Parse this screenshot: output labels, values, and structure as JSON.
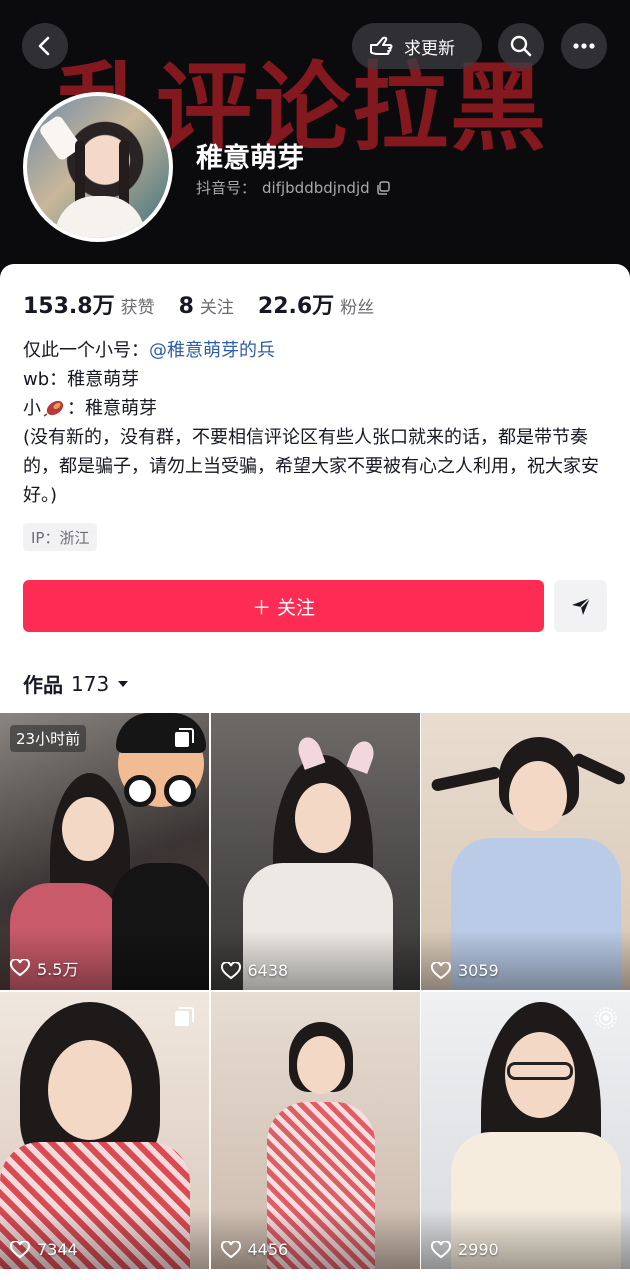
{
  "header": {
    "banner_text": "乱评论拉黑",
    "update_label": "求更新",
    "profile_name": "稚意萌芽",
    "douyin_id_label": "抖音号：",
    "douyin_id": "difjbddbdjndjd"
  },
  "stats": [
    {
      "value": "153.8万",
      "label": "获赞"
    },
    {
      "value": "8",
      "label": "关注"
    },
    {
      "value": "22.6万",
      "label": "粉丝"
    }
  ],
  "bio": {
    "line1_prefix": "仅此一个小号：",
    "line1_mention": "@稚意萌芽的兵",
    "line2": "wb：稚意萌芽",
    "line3_prefix": "小",
    "line3_suffix": "：稚意萌芽",
    "paragraph": "(没有新的，没有群，不要相信评论区有些人张口就来的话，都是带节奏的，都是骗子，请勿上当受骗，希望大家不要被有心之人利用，祝大家安好。)"
  },
  "ip_tag": "IP：浙江",
  "actions": {
    "follow_label": "＋ 关注"
  },
  "works": {
    "label": "作品",
    "count": "173"
  },
  "videos": [
    {
      "likes": "5.5万",
      "badge": "23小时前"
    },
    {
      "likes": "6438"
    },
    {
      "likes": "3059"
    },
    {
      "likes": "7344"
    },
    {
      "likes": "4456"
    },
    {
      "likes": "2990"
    }
  ],
  "colors": {
    "accent": "#fe2c55",
    "mention": "#2d5fa6",
    "banner": "#8a1a1f"
  }
}
